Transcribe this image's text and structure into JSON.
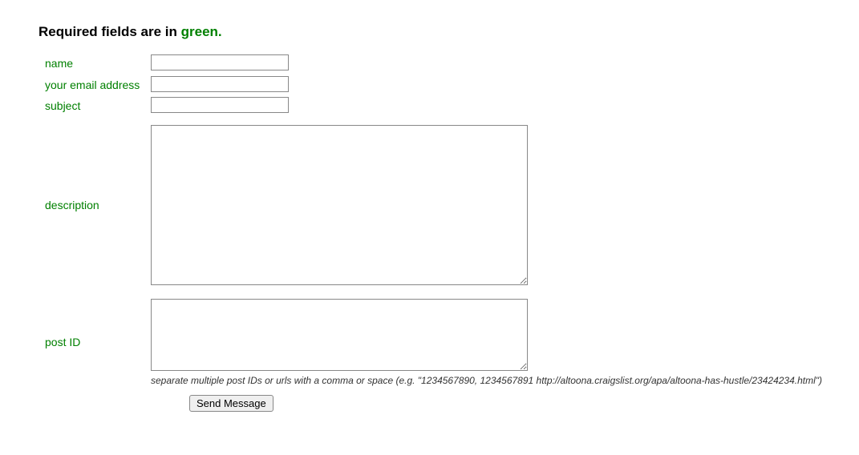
{
  "heading": {
    "prefix": "Required fields are in ",
    "green_word": "green."
  },
  "fields": {
    "name_label": "name",
    "name_value": "",
    "email_label": "your email address",
    "email_value": "",
    "subject_label": "subject",
    "subject_value": "",
    "description_label": "description",
    "description_value": "",
    "postid_label": "post ID",
    "postid_value": "",
    "postid_hint": "separate multiple post IDs or urls with a comma or space (e.g. \"1234567890, 1234567891 http://altoona.craigslist.org/apa/altoona-has-hustle/23424234.html\")"
  },
  "submit_label": "Send Message"
}
